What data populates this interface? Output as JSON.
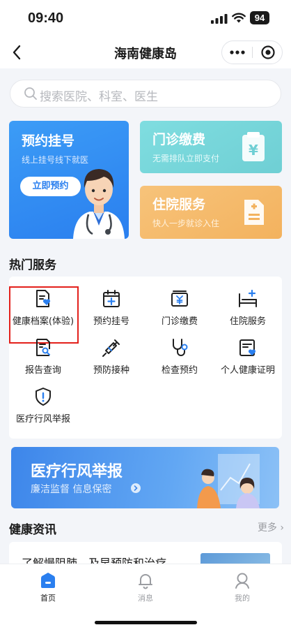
{
  "status_bar": {
    "time": "09:40",
    "battery": "94"
  },
  "nav": {
    "title": "海南健康岛"
  },
  "search": {
    "placeholder": "搜索医院、科室、医生"
  },
  "cards": {
    "appointment": {
      "title": "预约挂号",
      "subtitle": "线上挂号线下就医",
      "button": "立即预约"
    },
    "outpatient": {
      "title": "门诊缴费",
      "subtitle": "无需排队立即支付",
      "icon_text": "¥"
    },
    "inpatient": {
      "title": "住院服务",
      "subtitle": "快人一步就诊入住"
    }
  },
  "hot_services": {
    "title": "热门服务",
    "items": [
      {
        "label": "健康档案(体验)",
        "icon": "health-record-icon"
      },
      {
        "label": "预约挂号",
        "icon": "calendar-plus-icon"
      },
      {
        "label": "门诊缴费",
        "icon": "payment-icon"
      },
      {
        "label": "住院服务",
        "icon": "bed-icon"
      },
      {
        "label": "报告查询",
        "icon": "report-search-icon"
      },
      {
        "label": "预防接种",
        "icon": "syringe-icon"
      },
      {
        "label": "检查预约",
        "icon": "stethoscope-icon"
      },
      {
        "label": "个人健康证明",
        "icon": "health-certificate-icon"
      },
      {
        "label": "医疗行风举报",
        "icon": "shield-alert-icon"
      }
    ]
  },
  "banner": {
    "title": "医疗行风举报",
    "subtitle": "廉洁监督 信息保密"
  },
  "news": {
    "title": "健康资讯",
    "more": "更多",
    "first_item": "了解慢阻肺，及早预防和治疗"
  },
  "tabs": [
    {
      "label": "首页",
      "icon": "home-icon",
      "active": true
    },
    {
      "label": "消息",
      "icon": "bell-icon",
      "active": false
    },
    {
      "label": "我的",
      "icon": "user-icon",
      "active": false
    }
  ],
  "colors": {
    "primary": "#2a7fef",
    "teal_card": "#6fcfd4",
    "orange_card": "#f3b25e",
    "highlight_border": "#e3201b"
  }
}
